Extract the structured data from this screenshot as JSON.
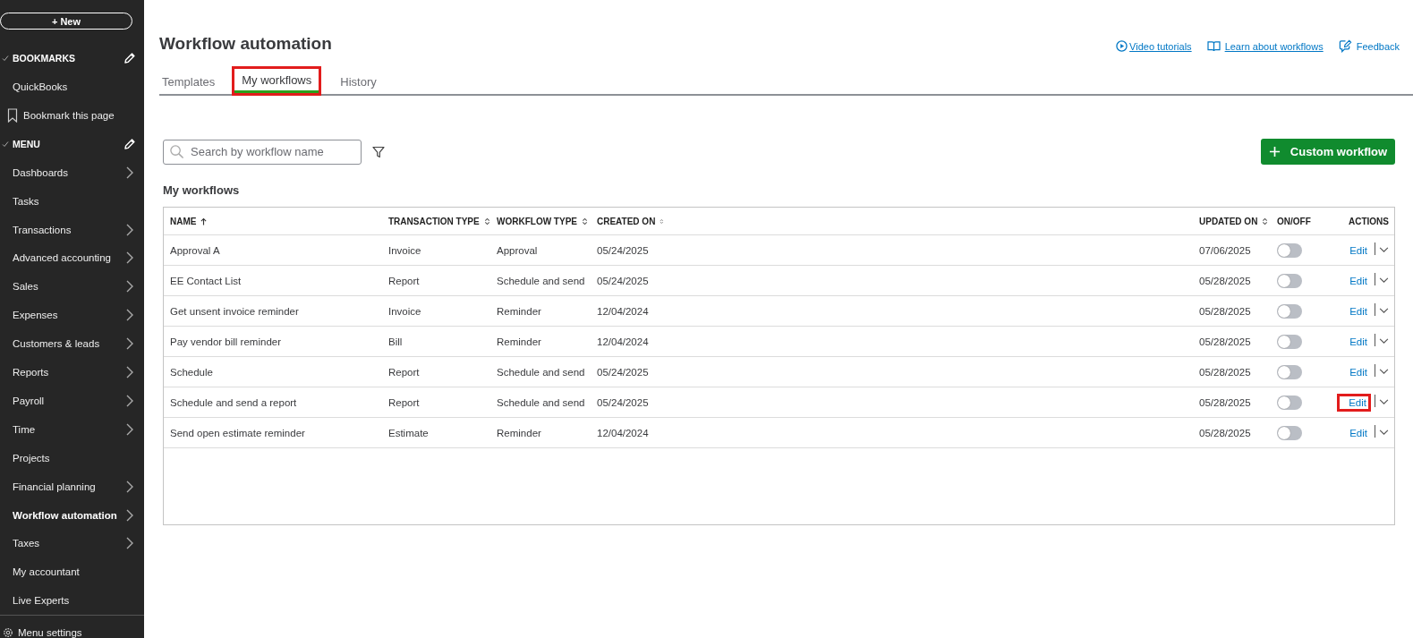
{
  "sidebar": {
    "new_button": "+ New",
    "bookmarks": {
      "label": "BOOKMARKS",
      "items": [
        "QuickBooks"
      ],
      "add": "Bookmark this page"
    },
    "menu_label": "MENU",
    "items": [
      {
        "label": "Dashboards",
        "chevron": true,
        "selected": false
      },
      {
        "label": "Tasks",
        "chevron": false,
        "selected": false
      },
      {
        "label": "Transactions",
        "chevron": true,
        "selected": false
      },
      {
        "label": "Advanced accounting",
        "chevron": true,
        "selected": false
      },
      {
        "label": "Sales",
        "chevron": true,
        "selected": false
      },
      {
        "label": "Expenses",
        "chevron": true,
        "selected": false
      },
      {
        "label": "Customers & leads",
        "chevron": true,
        "selected": false
      },
      {
        "label": "Reports",
        "chevron": true,
        "selected": false
      },
      {
        "label": "Payroll",
        "chevron": true,
        "selected": false
      },
      {
        "label": "Time",
        "chevron": true,
        "selected": false
      },
      {
        "label": "Projects",
        "chevron": false,
        "selected": false
      },
      {
        "label": "Financial planning",
        "chevron": true,
        "selected": false
      },
      {
        "label": "Workflow automation",
        "chevron": true,
        "selected": true
      },
      {
        "label": "Taxes",
        "chevron": true,
        "selected": false
      },
      {
        "label": "My accountant",
        "chevron": false,
        "selected": false
      },
      {
        "label": "Live Experts",
        "chevron": false,
        "selected": false
      }
    ],
    "settings": "Menu settings"
  },
  "page": {
    "title": "Workflow automation",
    "links": [
      {
        "kind": "video",
        "label": "Video tutorials"
      },
      {
        "kind": "book",
        "label": "Learn about workflows"
      },
      {
        "kind": "feedback",
        "label": "Feedback"
      }
    ],
    "tabs": [
      {
        "label": "Templates",
        "selected": false
      },
      {
        "label": "My workflows",
        "selected": true,
        "highlighted": true
      },
      {
        "label": "History",
        "selected": false
      }
    ],
    "search": {
      "placeholder": "Search by workflow name"
    },
    "custom_button": "Custom workflow",
    "section_title": "My workflows"
  },
  "table": {
    "columns": [
      {
        "label": "NAME",
        "sorted": true,
        "sortable": true
      },
      {
        "label": "TRANSACTION TYPE",
        "sorted": false,
        "sortable": true
      },
      {
        "label": "WORKFLOW TYPE",
        "sorted": false,
        "sortable": true
      },
      {
        "label": "CREATED ON",
        "sorted": false,
        "sortable": true
      },
      {
        "label": "UPDATED ON",
        "sorted": false,
        "sortable": true
      },
      {
        "label": "ON/OFF",
        "sorted": false,
        "sortable": false
      },
      {
        "label": "ACTIONS",
        "sorted": false,
        "sortable": false
      }
    ],
    "rows": [
      {
        "name": "Approval A",
        "transaction_type": "Invoice",
        "workflow_type": "Approval",
        "created_on": "05/24/2025",
        "updated_on": "07/06/2025",
        "on": false,
        "action": "Edit",
        "highlighted": false
      },
      {
        "name": "EE Contact List",
        "transaction_type": "Report",
        "workflow_type": "Schedule and send",
        "created_on": "05/24/2025",
        "updated_on": "05/28/2025",
        "on": false,
        "action": "Edit",
        "highlighted": false
      },
      {
        "name": "Get unsent invoice reminder",
        "transaction_type": "Invoice",
        "workflow_type": "Reminder",
        "created_on": "12/04/2024",
        "updated_on": "05/28/2025",
        "on": false,
        "action": "Edit",
        "highlighted": false
      },
      {
        "name": "Pay vendor bill reminder",
        "transaction_type": "Bill",
        "workflow_type": "Reminder",
        "created_on": "12/04/2024",
        "updated_on": "05/28/2025",
        "on": false,
        "action": "Edit",
        "highlighted": false
      },
      {
        "name": "Schedule",
        "transaction_type": "Report",
        "workflow_type": "Schedule and send",
        "created_on": "05/24/2025",
        "updated_on": "05/28/2025",
        "on": false,
        "action": "Edit",
        "highlighted": false
      },
      {
        "name": "Schedule and send a report",
        "transaction_type": "Report",
        "workflow_type": "Schedule and send",
        "created_on": "05/24/2025",
        "updated_on": "05/28/2025",
        "on": false,
        "action": "Edit",
        "highlighted": true
      },
      {
        "name": "Send open estimate reminder",
        "transaction_type": "Estimate",
        "workflow_type": "Reminder",
        "created_on": "12/04/2024",
        "updated_on": "05/28/2025",
        "on": false,
        "action": "Edit",
        "highlighted": false
      }
    ]
  }
}
